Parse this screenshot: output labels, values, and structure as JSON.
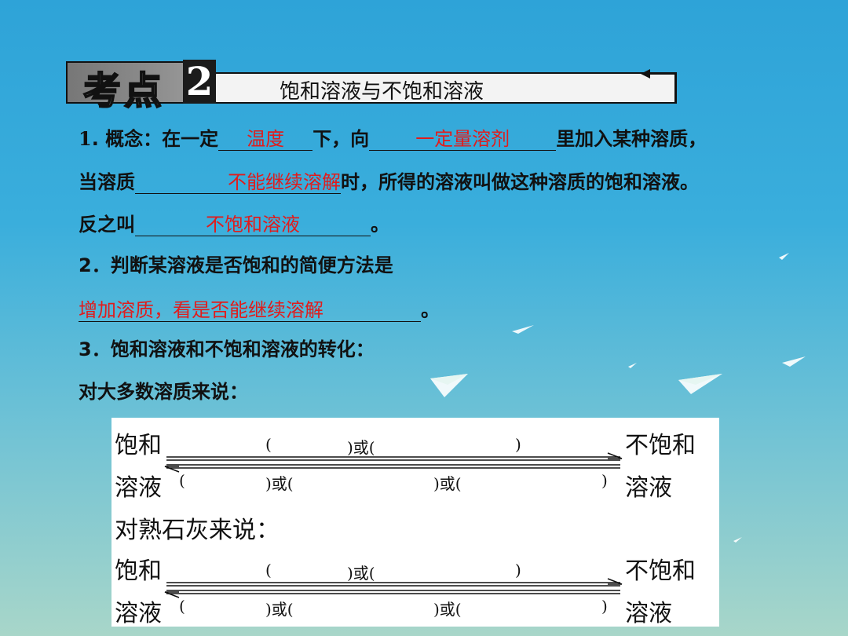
{
  "header": {
    "badge": "考点",
    "number": "2",
    "title": "饱和溶液与不饱和溶液"
  },
  "lines": {
    "l1_num": "1",
    "l1_a": ". 概念：在一定",
    "l1_ans1": "温度",
    "l1_b": "下，向",
    "l1_ans2": "一定量溶剂",
    "l1_c": "里加入某种溶质，",
    "l2_a": "当溶质",
    "l2_ans": "不能继续溶解",
    "l2_b": "时，所得的溶液叫做这种溶质的饱和溶液。",
    "l3_a": "反之叫",
    "l3_ans": "不饱和溶液",
    "l3_b": "。",
    "l4": "2．判断某溶液是否饱和的简便方法是",
    "l5_ans": "增加溶质，看是否能继续溶解",
    "l5_b": "。",
    "l6": "3．饱和溶液和不饱和溶液的转化：",
    "l7": "对大多数溶质来说："
  },
  "panel": {
    "sat1": "饱和",
    "sol1": "溶液",
    "unsat1": "不饱和",
    "unsol1": "溶液",
    "top1_a": "(",
    "top1_or": ")或(",
    "top1_end": ")",
    "bot1_a": "(",
    "bot1_or1": ")或(",
    "bot1_or2": ")或(",
    "bot1_end": ")",
    "lime": "对熟石灰来说：",
    "sat2": "饱和",
    "sol2": "溶液",
    "unsat2": "不饱和",
    "unsol2": "溶液",
    "top2_a": "(",
    "top2_or": ")或(",
    "top2_end": ")",
    "bot2_a": "(",
    "bot2_or1": ")或(",
    "bot2_or2": ")或(",
    "bot2_end": ")"
  },
  "colors": {
    "answer": "#e11c1c",
    "background_top": "#2ea3d8",
    "background_bottom": "#a8d6c9"
  }
}
